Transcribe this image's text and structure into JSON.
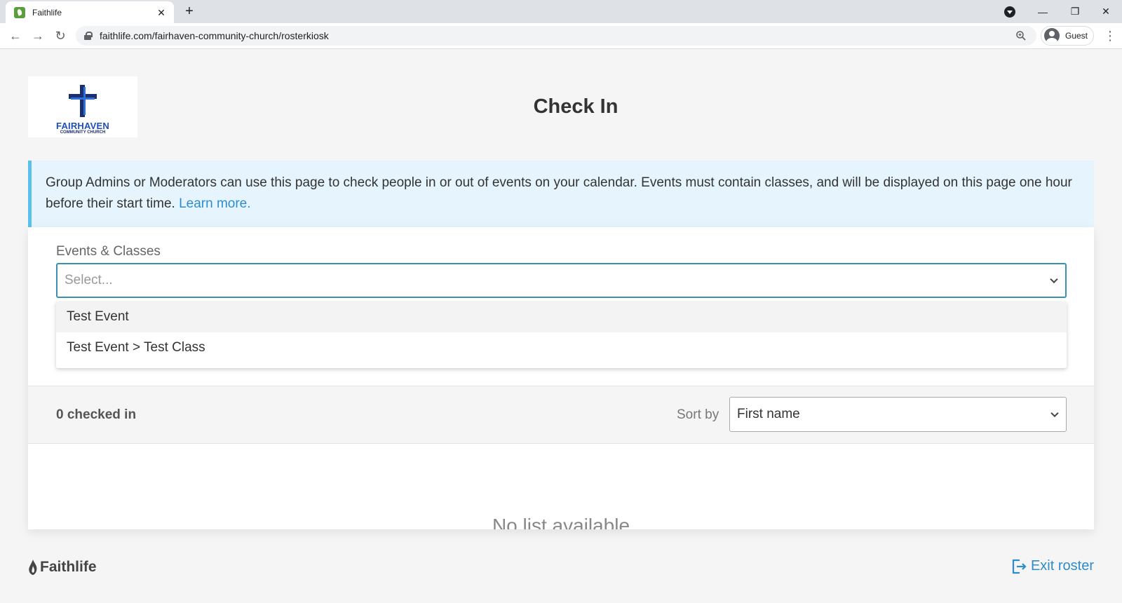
{
  "browser": {
    "tab_title": "Faithlife",
    "tab_close": "✕",
    "new_tab": "+",
    "url": "faithlife.com/fairhaven-community-church/rosterkiosk",
    "profile_label": "Guest",
    "minimize": "—",
    "restore": "❐",
    "close": "✕",
    "back": "←",
    "forward": "→",
    "reload": "↻",
    "menu": "⋮"
  },
  "logo": {
    "name": "FAIRHAVEN",
    "subtitle": "COMMUNITY CHURCH"
  },
  "page": {
    "title": "Check In",
    "info_text": "Group Admins or Moderators can use this page to check people in or out of events on your calendar. Events must contain classes, and will be displayed on this page one hour before their start time. ",
    "learn_more": "Learn more."
  },
  "events": {
    "label": "Events & Classes",
    "placeholder": "Select...",
    "options": [
      {
        "label": "Test Event"
      },
      {
        "label": "Test Event > Test Class"
      }
    ]
  },
  "roster": {
    "count_text": "0 checked in",
    "sort_label": "Sort by",
    "sort_value": "First name",
    "empty_text": "No list available"
  },
  "footer": {
    "brand": "Faithlife",
    "exit_label": "Exit roster"
  },
  "colors": {
    "accent": "#2f8ccb",
    "info_bg": "#e6f5fd",
    "info_border": "#5bc0ec",
    "focus_border": "#3d8fb0"
  }
}
